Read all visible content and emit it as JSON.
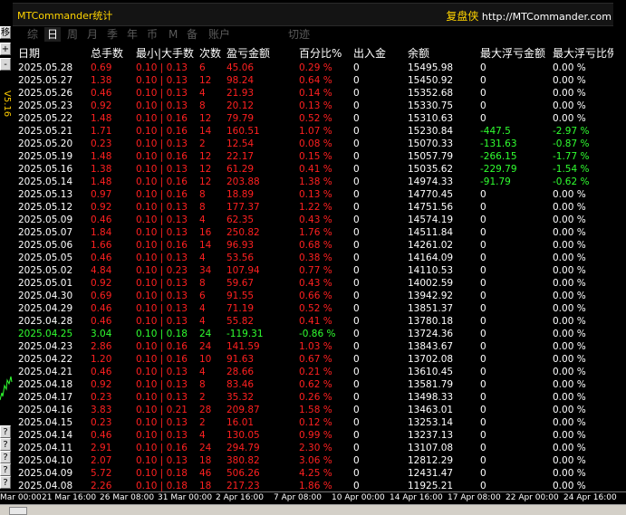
{
  "window": {
    "title": "MTCommander统计"
  },
  "brand": {
    "name": "复盘侠",
    "url": "http://MTCommander.com"
  },
  "left_toolbar": {
    "buttons": [
      "移",
      "+",
      "-",
      "?",
      "?",
      "?",
      "?",
      "?"
    ],
    "version": "V5.16"
  },
  "tabs": [
    "综",
    "日",
    "周",
    "月",
    "季",
    "年",
    "币",
    "M",
    "备",
    "账户",
    "切迹"
  ],
  "active_tab": "日",
  "columns": [
    "日期",
    "总手数",
    "最小|大手数",
    "次数",
    "盈亏金额",
    "百分比%",
    "出入金",
    "余额",
    "最大浮亏金额",
    "最大浮亏比例"
  ],
  "rows": [
    {
      "date": "2025.05.28",
      "lots": "0.69",
      "minmax": "0.10 | 0.13",
      "count": "6",
      "pnl": "45.06",
      "pct": "0.29 %",
      "flow": "0",
      "balance": "15495.98",
      "dd": "0",
      "ddpct": "0.00 %",
      "status": "profit"
    },
    {
      "date": "2025.05.27",
      "lots": "1.38",
      "minmax": "0.10 | 0.13",
      "count": "12",
      "pnl": "98.24",
      "pct": "0.64 %",
      "flow": "0",
      "balance": "15450.92",
      "dd": "0",
      "ddpct": "0.00 %",
      "status": "profit"
    },
    {
      "date": "2025.05.26",
      "lots": "0.46",
      "minmax": "0.10 | 0.13",
      "count": "4",
      "pnl": "21.93",
      "pct": "0.14 %",
      "flow": "0",
      "balance": "15352.68",
      "dd": "0",
      "ddpct": "0.00 %",
      "status": "profit"
    },
    {
      "date": "2025.05.23",
      "lots": "0.92",
      "minmax": "0.10 | 0.13",
      "count": "8",
      "pnl": "20.12",
      "pct": "0.13 %",
      "flow": "0",
      "balance": "15330.75",
      "dd": "0",
      "ddpct": "0.00 %",
      "status": "profit"
    },
    {
      "date": "2025.05.22",
      "lots": "1.48",
      "minmax": "0.10 | 0.16",
      "count": "12",
      "pnl": "79.79",
      "pct": "0.52 %",
      "flow": "0",
      "balance": "15310.63",
      "dd": "0",
      "ddpct": "0.00 %",
      "status": "profit"
    },
    {
      "date": "2025.05.21",
      "lots": "1.71",
      "minmax": "0.10 | 0.16",
      "count": "14",
      "pnl": "160.51",
      "pct": "1.07 %",
      "flow": "0",
      "balance": "15230.84",
      "dd": "-447.5",
      "ddpct": "-2.97 %",
      "status": "profit"
    },
    {
      "date": "2025.05.20",
      "lots": "0.23",
      "minmax": "0.10 | 0.13",
      "count": "2",
      "pnl": "12.54",
      "pct": "0.08 %",
      "flow": "0",
      "balance": "15070.33",
      "dd": "-131.63",
      "ddpct": "-0.87 %",
      "status": "profit"
    },
    {
      "date": "2025.05.19",
      "lots": "1.48",
      "minmax": "0.10 | 0.16",
      "count": "12",
      "pnl": "22.17",
      "pct": "0.15 %",
      "flow": "0",
      "balance": "15057.79",
      "dd": "-266.15",
      "ddpct": "-1.77 %",
      "status": "profit"
    },
    {
      "date": "2025.05.16",
      "lots": "1.38",
      "minmax": "0.10 | 0.13",
      "count": "12",
      "pnl": "61.29",
      "pct": "0.41 %",
      "flow": "0",
      "balance": "15035.62",
      "dd": "-229.79",
      "ddpct": "-1.54 %",
      "status": "profit"
    },
    {
      "date": "2025.05.14",
      "lots": "1.48",
      "minmax": "0.10 | 0.16",
      "count": "12",
      "pnl": "203.88",
      "pct": "1.38 %",
      "flow": "0",
      "balance": "14974.33",
      "dd": "-91.79",
      "ddpct": "-0.62 %",
      "status": "profit"
    },
    {
      "date": "2025.05.13",
      "lots": "0.97",
      "minmax": "0.10 | 0.16",
      "count": "8",
      "pnl": "18.89",
      "pct": "0.13 %",
      "flow": "0",
      "balance": "14770.45",
      "dd": "0",
      "ddpct": "0.00 %",
      "status": "profit"
    },
    {
      "date": "2025.05.12",
      "lots": "0.92",
      "minmax": "0.10 | 0.13",
      "count": "8",
      "pnl": "177.37",
      "pct": "1.22 %",
      "flow": "0",
      "balance": "14751.56",
      "dd": "0",
      "ddpct": "0.00 %",
      "status": "profit"
    },
    {
      "date": "2025.05.09",
      "lots": "0.46",
      "minmax": "0.10 | 0.13",
      "count": "4",
      "pnl": "62.35",
      "pct": "0.43 %",
      "flow": "0",
      "balance": "14574.19",
      "dd": "0",
      "ddpct": "0.00 %",
      "status": "profit"
    },
    {
      "date": "2025.05.07",
      "lots": "1.84",
      "minmax": "0.10 | 0.13",
      "count": "16",
      "pnl": "250.82",
      "pct": "1.76 %",
      "flow": "0",
      "balance": "14511.84",
      "dd": "0",
      "ddpct": "0.00 %",
      "status": "profit"
    },
    {
      "date": "2025.05.06",
      "lots": "1.66",
      "minmax": "0.10 | 0.16",
      "count": "14",
      "pnl": "96.93",
      "pct": "0.68 %",
      "flow": "0",
      "balance": "14261.02",
      "dd": "0",
      "ddpct": "0.00 %",
      "status": "profit"
    },
    {
      "date": "2025.05.05",
      "lots": "0.46",
      "minmax": "0.10 | 0.13",
      "count": "4",
      "pnl": "53.56",
      "pct": "0.38 %",
      "flow": "0",
      "balance": "14164.09",
      "dd": "0",
      "ddpct": "0.00 %",
      "status": "profit"
    },
    {
      "date": "2025.05.02",
      "lots": "4.84",
      "minmax": "0.10 | 0.23",
      "count": "34",
      "pnl": "107.94",
      "pct": "0.77 %",
      "flow": "0",
      "balance": "14110.53",
      "dd": "0",
      "ddpct": "0.00 %",
      "status": "profit"
    },
    {
      "date": "2025.05.01",
      "lots": "0.92",
      "minmax": "0.10 | 0.13",
      "count": "8",
      "pnl": "59.67",
      "pct": "0.43 %",
      "flow": "0",
      "balance": "14002.59",
      "dd": "0",
      "ddpct": "0.00 %",
      "status": "profit"
    },
    {
      "date": "2025.04.30",
      "lots": "0.69",
      "minmax": "0.10 | 0.13",
      "count": "6",
      "pnl": "91.55",
      "pct": "0.66 %",
      "flow": "0",
      "balance": "13942.92",
      "dd": "0",
      "ddpct": "0.00 %",
      "status": "profit"
    },
    {
      "date": "2025.04.29",
      "lots": "0.46",
      "minmax": "0.10 | 0.13",
      "count": "4",
      "pnl": "71.19",
      "pct": "0.52 %",
      "flow": "0",
      "balance": "13851.37",
      "dd": "0",
      "ddpct": "0.00 %",
      "status": "profit"
    },
    {
      "date": "2025.04.28",
      "lots": "0.46",
      "minmax": "0.10 | 0.13",
      "count": "4",
      "pnl": "55.82",
      "pct": "0.41 %",
      "flow": "0",
      "balance": "13780.18",
      "dd": "0",
      "ddpct": "0.00 %",
      "status": "profit"
    },
    {
      "date": "2025.04.25",
      "lots": "3.04",
      "minmax": "0.10 | 0.18",
      "count": "24",
      "pnl": "-119.31",
      "pct": "-0.86 %",
      "flow": "0",
      "balance": "13724.36",
      "dd": "0",
      "ddpct": "0.00 %",
      "status": "loss"
    },
    {
      "date": "2025.04.23",
      "lots": "2.86",
      "minmax": "0.10 | 0.16",
      "count": "24",
      "pnl": "141.59",
      "pct": "1.03 %",
      "flow": "0",
      "balance": "13843.67",
      "dd": "0",
      "ddpct": "0.00 %",
      "status": "profit"
    },
    {
      "date": "2025.04.22",
      "lots": "1.20",
      "minmax": "0.10 | 0.16",
      "count": "10",
      "pnl": "91.63",
      "pct": "0.67 %",
      "flow": "0",
      "balance": "13702.08",
      "dd": "0",
      "ddpct": "0.00 %",
      "status": "profit"
    },
    {
      "date": "2025.04.21",
      "lots": "0.46",
      "minmax": "0.10 | 0.13",
      "count": "4",
      "pnl": "28.66",
      "pct": "0.21 %",
      "flow": "0",
      "balance": "13610.45",
      "dd": "0",
      "ddpct": "0.00 %",
      "status": "profit"
    },
    {
      "date": "2025.04.18",
      "lots": "0.92",
      "minmax": "0.10 | 0.13",
      "count": "8",
      "pnl": "83.46",
      "pct": "0.62 %",
      "flow": "0",
      "balance": "13581.79",
      "dd": "0",
      "ddpct": "0.00 %",
      "status": "profit"
    },
    {
      "date": "2025.04.17",
      "lots": "0.23",
      "minmax": "0.10 | 0.13",
      "count": "2",
      "pnl": "35.32",
      "pct": "0.26 %",
      "flow": "0",
      "balance": "13498.33",
      "dd": "0",
      "ddpct": "0.00 %",
      "status": "profit"
    },
    {
      "date": "2025.04.16",
      "lots": "3.83",
      "minmax": "0.10 | 0.21",
      "count": "28",
      "pnl": "209.87",
      "pct": "1.58 %",
      "flow": "0",
      "balance": "13463.01",
      "dd": "0",
      "ddpct": "0.00 %",
      "status": "profit"
    },
    {
      "date": "2025.04.15",
      "lots": "0.23",
      "minmax": "0.10 | 0.13",
      "count": "2",
      "pnl": "16.01",
      "pct": "0.12 %",
      "flow": "0",
      "balance": "13253.14",
      "dd": "0",
      "ddpct": "0.00 %",
      "status": "profit"
    },
    {
      "date": "2025.04.14",
      "lots": "0.46",
      "minmax": "0.10 | 0.13",
      "count": "4",
      "pnl": "130.05",
      "pct": "0.99 %",
      "flow": "0",
      "balance": "13237.13",
      "dd": "0",
      "ddpct": "0.00 %",
      "status": "profit"
    },
    {
      "date": "2025.04.11",
      "lots": "2.91",
      "minmax": "0.10 | 0.16",
      "count": "24",
      "pnl": "294.79",
      "pct": "2.30 %",
      "flow": "0",
      "balance": "13107.08",
      "dd": "0",
      "ddpct": "0.00 %",
      "status": "profit"
    },
    {
      "date": "2025.04.10",
      "lots": "2.07",
      "minmax": "0.10 | 0.13",
      "count": "18",
      "pnl": "380.82",
      "pct": "3.06 %",
      "flow": "0",
      "balance": "12812.29",
      "dd": "0",
      "ddpct": "0.00 %",
      "status": "profit"
    },
    {
      "date": "2025.04.09",
      "lots": "5.72",
      "minmax": "0.10 | 0.18",
      "count": "46",
      "pnl": "506.26",
      "pct": "4.25 %",
      "flow": "0",
      "balance": "12431.47",
      "dd": "0",
      "ddpct": "0.00 %",
      "status": "profit"
    },
    {
      "date": "2025.04.08",
      "lots": "2.26",
      "minmax": "0.10 | 0.18",
      "count": "18",
      "pnl": "217.23",
      "pct": "1.86 %",
      "flow": "0",
      "balance": "11925.21",
      "dd": "0",
      "ddpct": "0.00 %",
      "status": "profit"
    }
  ],
  "time_axis": [
    "Mar 00:00",
    "21 Mar 16:00",
    "26 Mar 08:00",
    "31 Mar 00:00",
    "2 Apr 16:00",
    "7 Apr 08:00",
    "10 Apr 00:00",
    "14 Apr 16:00",
    "17 Apr 08:00",
    "22 Apr 00:00",
    "24 Apr 16:00"
  ],
  "colors": {
    "profit": "#ff2020",
    "loss": "#30ff30",
    "title": "#ffd400",
    "background": "#000000"
  }
}
